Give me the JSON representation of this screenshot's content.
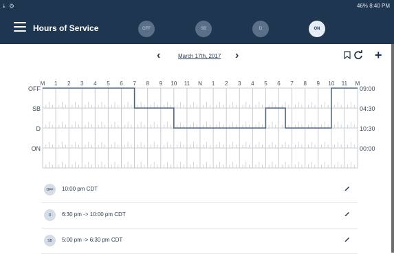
{
  "statusbar": {
    "left_icons": "⤓ ⚙",
    "right_text": "46% 8:40 PM"
  },
  "header": {
    "title": "Hours of Service",
    "statuses": [
      {
        "label": "OFF",
        "active": false
      },
      {
        "label": "SB",
        "active": false
      },
      {
        "label": "D",
        "active": false
      },
      {
        "label": "ON",
        "active": true
      }
    ]
  },
  "date_nav": {
    "date": "March 17th, 2017",
    "prev": "‹",
    "next": "›",
    "add": "+"
  },
  "chart_data": {
    "type": "line",
    "x_ticks": [
      "M",
      "1",
      "2",
      "3",
      "4",
      "5",
      "6",
      "7",
      "8",
      "9",
      "10",
      "11",
      "N",
      "1",
      "2",
      "3",
      "4",
      "5",
      "6",
      "7",
      "8",
      "9",
      "10",
      "11",
      "M"
    ],
    "y_categories": [
      "OFF",
      "SB",
      "D",
      "ON"
    ],
    "totals": [
      "09:00",
      "04:30",
      "10:30",
      "00:00"
    ],
    "segments": [
      {
        "status": "OFF",
        "start": 0,
        "end": 7
      },
      {
        "status": "SB",
        "start": 7,
        "end": 10
      },
      {
        "status": "D",
        "start": 10,
        "end": 17
      },
      {
        "status": "SB",
        "start": 17,
        "end": 18.5
      },
      {
        "status": "D",
        "start": 18.5,
        "end": 22
      },
      {
        "status": "OFF",
        "start": 22,
        "end": 24
      }
    ]
  },
  "logs": [
    {
      "status": "OFF",
      "text": "10:00 pm CDT"
    },
    {
      "status": "D",
      "text": "6:30 pm -> 10:00 pm CDT"
    },
    {
      "status": "SB",
      "text": "5:00 pm -> 6:30 pm CDT"
    }
  ]
}
